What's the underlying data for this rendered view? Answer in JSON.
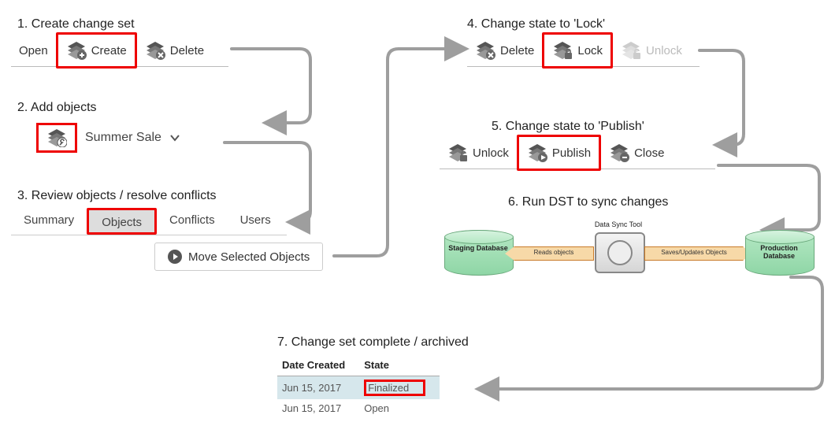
{
  "steps": {
    "s1": {
      "title": "1. Create change set"
    },
    "s2": {
      "title": "2. Add objects"
    },
    "s3": {
      "title": "3. Review objects / resolve conflicts"
    },
    "s4": {
      "title": "4. Change state to 'Lock'"
    },
    "s5": {
      "title": "5. Change state to 'Publish'"
    },
    "s6": {
      "title": "6. Run DST to sync changes"
    },
    "s7": {
      "title": "7. Change set complete / archived"
    }
  },
  "toolbar1": {
    "open": "Open",
    "create": "Create",
    "delete": "Delete"
  },
  "step2": {
    "name": "Summer Sale"
  },
  "tabs": {
    "summary": "Summary",
    "objects": "Objects",
    "conflicts": "Conflicts",
    "users": "Users"
  },
  "moveBtn": "Move Selected Objects",
  "toolbar4": {
    "delete": "Delete",
    "lock": "Lock",
    "unlock": "Unlock"
  },
  "toolbar5": {
    "unlock": "Unlock",
    "publish": "Publish",
    "close": "Close"
  },
  "dst": {
    "title": "Data Sync Tool",
    "staging": "Staging Database",
    "production": "Production Database",
    "reads": "Reads objects",
    "saves": "Saves/Updates Objects"
  },
  "table": {
    "h1": "Date Created",
    "h2": "State",
    "r1": {
      "date": "Jun 15, 2017",
      "state": "Finalized"
    },
    "r2": {
      "date": "Jun 15, 2017",
      "state": "Open"
    }
  }
}
